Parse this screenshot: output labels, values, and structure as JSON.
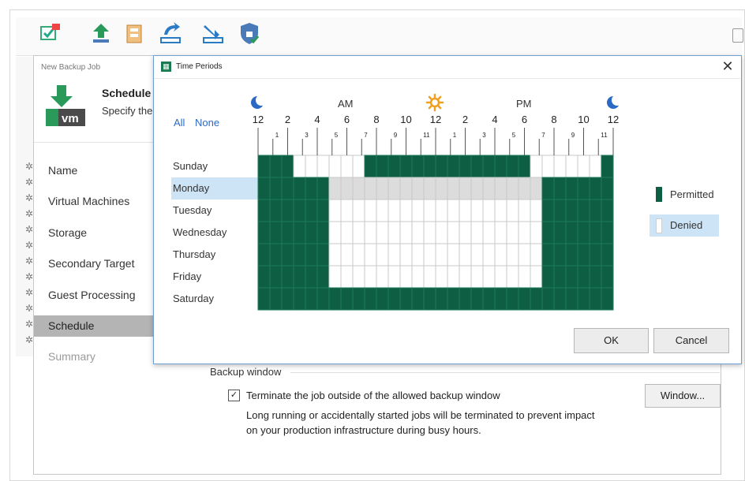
{
  "toolbar": {
    "items": [
      {
        "label": "SureBackup",
        "icon": "surebackup-icon"
      },
      {
        "label": "Restore",
        "icon": "restore-icon"
      },
      {
        "label": "Failover",
        "icon": "failover-icon"
      },
      {
        "label": "Import",
        "icon": "import-icon"
      },
      {
        "label": "Export",
        "icon": "export-icon"
      },
      {
        "label": "Security & Compliance",
        "icon": "security-icon"
      }
    ]
  },
  "wizard": {
    "title": "New Backup Job",
    "header_title": "Schedule",
    "header_desc": "Specify the",
    "steps": [
      {
        "label": "Name",
        "state": "normal"
      },
      {
        "label": "Virtual Machines",
        "state": "normal"
      },
      {
        "label": "Storage",
        "state": "normal"
      },
      {
        "label": "Secondary Target",
        "state": "normal"
      },
      {
        "label": "Guest Processing",
        "state": "normal"
      },
      {
        "label": "Schedule",
        "state": "active"
      },
      {
        "label": "Summary",
        "state": "disabled"
      }
    ],
    "backup_window": {
      "section_label": "Backup window",
      "checkbox_checked": true,
      "checkbox_label": "Terminate the job outside of the allowed backup window",
      "desc_line1": "Long running or accidentally started jobs will be terminated to prevent impact",
      "desc_line2": "on your production infrastructure during busy hours.",
      "window_button": "Window..."
    }
  },
  "dialog": {
    "title": "Time Periods",
    "link_all": "All",
    "link_none": "None",
    "am_label": "AM",
    "pm_label": "PM",
    "hour_labels_major": [
      "12",
      "2",
      "4",
      "6",
      "8",
      "10",
      "12",
      "2",
      "4",
      "6",
      "8",
      "10",
      "12"
    ],
    "hour_labels_minor": [
      "1",
      "3",
      "5",
      "7",
      "9",
      "11",
      "1",
      "3",
      "5",
      "7",
      "9",
      "11"
    ],
    "days": [
      "Sunday",
      "Monday",
      "Tuesday",
      "Wednesday",
      "Thursday",
      "Friday",
      "Saturday"
    ],
    "selected_day": "Monday",
    "grid": [
      "111000000111111111111110000001",
      "111111000000000000000000111111",
      "111111000000000000000000111111",
      "111111000000000000000000111111",
      "111111000000000000000000111111",
      "111111000000000000000000111111",
      "111111111111111111111111111111"
    ],
    "legend": {
      "permitted": "Permitted",
      "denied": "Denied",
      "selected": "denied"
    },
    "ok": "OK",
    "cancel": "Cancel"
  },
  "colors": {
    "permitted": "#0e5e44",
    "denied": "#ffffff",
    "denied_selected_row": "#dcdcdc",
    "selection": "#cde4f6",
    "link": "#2a6ac4",
    "moon": "#2a6ac4",
    "sun": "#f0a020"
  }
}
